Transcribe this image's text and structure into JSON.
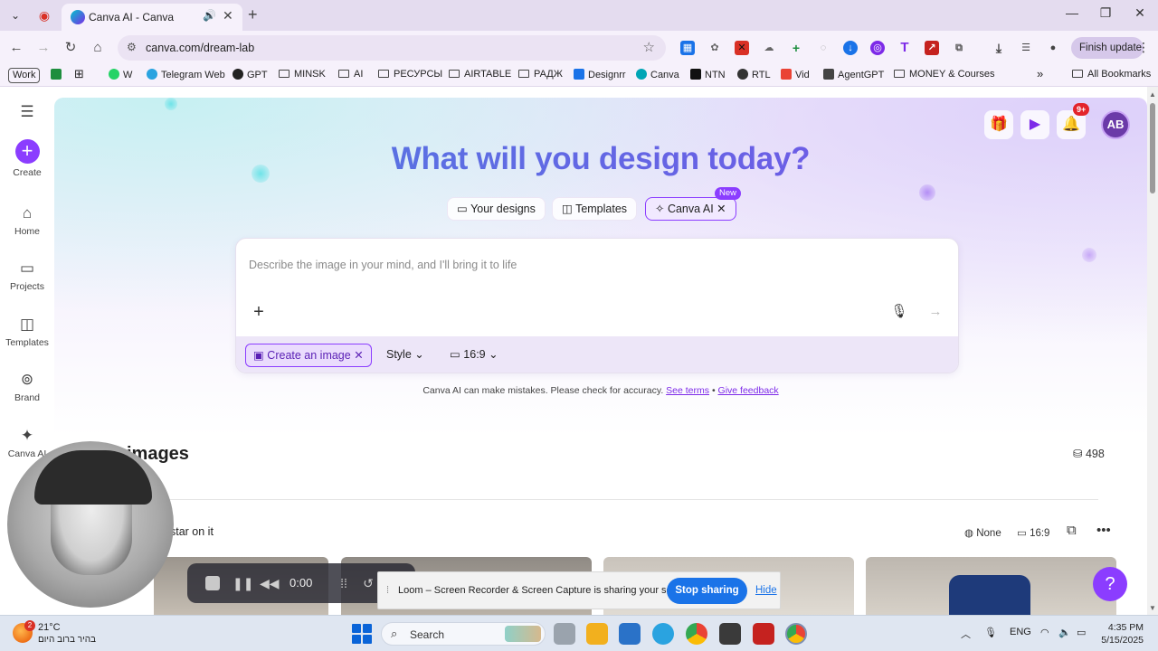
{
  "browser": {
    "tab_title": "Canva AI - Canva",
    "url": "canva.com/dream-lab",
    "finish_update": "Finish update",
    "bookmarks": [
      "Work",
      "W",
      "Telegram Web",
      "GPT",
      "MINSK",
      "AI",
      "РЕСУРСЫ",
      "AIRTABLE",
      "РАДЖ",
      "Designrr",
      "Canva",
      "NTN",
      "RTL",
      "Vid",
      "AgentGPT",
      "MONEY & Courses",
      "All Bookmarks"
    ]
  },
  "sidebar": {
    "items": [
      {
        "label": "Create",
        "icon": "plus-icon"
      },
      {
        "label": "Home",
        "icon": "home-icon"
      },
      {
        "label": "Projects",
        "icon": "folder-icon"
      },
      {
        "label": "Templates",
        "icon": "templates-icon"
      },
      {
        "label": "Brand",
        "icon": "brand-icon"
      },
      {
        "label": "Canva AI",
        "icon": "sparkle-icon"
      }
    ]
  },
  "header": {
    "title": "What will you design today?",
    "notifications_badge": "9+",
    "avatar_initials": "AB"
  },
  "tabs": [
    {
      "label": "Your designs"
    },
    {
      "label": "Templates"
    },
    {
      "label": "Canva AI",
      "badge": "New"
    }
  ],
  "prompt": {
    "placeholder": "Describe the image in your mind, and I'll bring it to life",
    "chips": {
      "create_image": "Create an image",
      "style": "Style",
      "ratio": "16:9"
    }
  },
  "disclaimer": {
    "text": "Canva AI can make mistakes. Please check for accuracy.",
    "see_terms": "See terms",
    "separator": "•",
    "give_feedback": "Give feedback"
  },
  "images_section": {
    "title": "images",
    "credits": "498",
    "prompt_fragment": "star on it",
    "style_value": "None",
    "ratio_value": "16:9"
  },
  "loom": {
    "timer": "0:00",
    "sharing_text": "Loom – Screen Recorder & Screen Capture is sharing your screen.",
    "stop_sharing": "Stop sharing",
    "hide": "Hide"
  },
  "taskbar": {
    "weather_temp": "21°C",
    "weather_desc": "בהיר ברוב היום",
    "weather_badge": "2",
    "search_label": "Search",
    "language": "ENG",
    "time": "4:35 PM",
    "date": "5/15/2025"
  },
  "colors": {
    "accent": "#8b3dff",
    "title_gradient_start": "#4c7fe0",
    "title_gradient_end": "#7a4fe8"
  }
}
